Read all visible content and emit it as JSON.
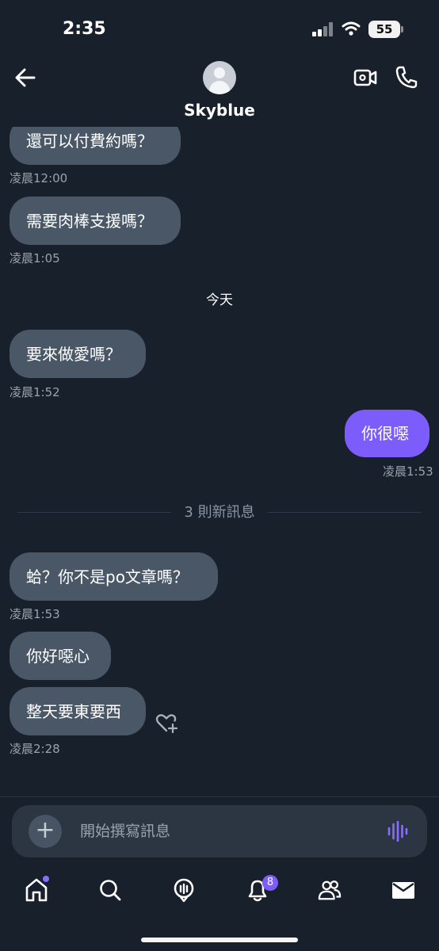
{
  "status": {
    "time": "2:35",
    "battery": "55"
  },
  "header": {
    "contact_name": "Skyblue"
  },
  "messages": [
    {
      "text": "還可以付費約嗎？",
      "time": "凌晨12:00"
    },
    {
      "text": "需要肉棒支援嗎？",
      "time": "凌晨1:05"
    },
    {
      "text": "要來做愛嗎？",
      "time": "凌晨1:52"
    },
    {
      "text": "你很噁",
      "time": "凌晨1:53"
    },
    {
      "text": "蛤？你不是po文章嗎？",
      "time": "凌晨1:53"
    },
    {
      "text": "你好噁心"
    },
    {
      "text": "整天要東要西",
      "time": "凌晨2:28"
    }
  ],
  "date_separator": "今天",
  "new_messages_label": "3 則新訊息",
  "composer": {
    "placeholder": "開始撰寫訊息"
  },
  "tabbar": {
    "notifications_badge": "8"
  },
  "icons": [
    "back-arrow-icon",
    "avatar-icon",
    "video-call-icon",
    "phone-icon",
    "heart-plus-icon",
    "plus-icon",
    "voice-wave-icon",
    "home-icon",
    "search-icon",
    "spaces-mic-icon",
    "bell-icon",
    "people-icon",
    "mail-icon"
  ],
  "colors": {
    "background": "#18202b",
    "incoming_bubble": "#4a5766",
    "outgoing_bubble": "#7c5cfa",
    "accent": "#7c5cfa"
  }
}
